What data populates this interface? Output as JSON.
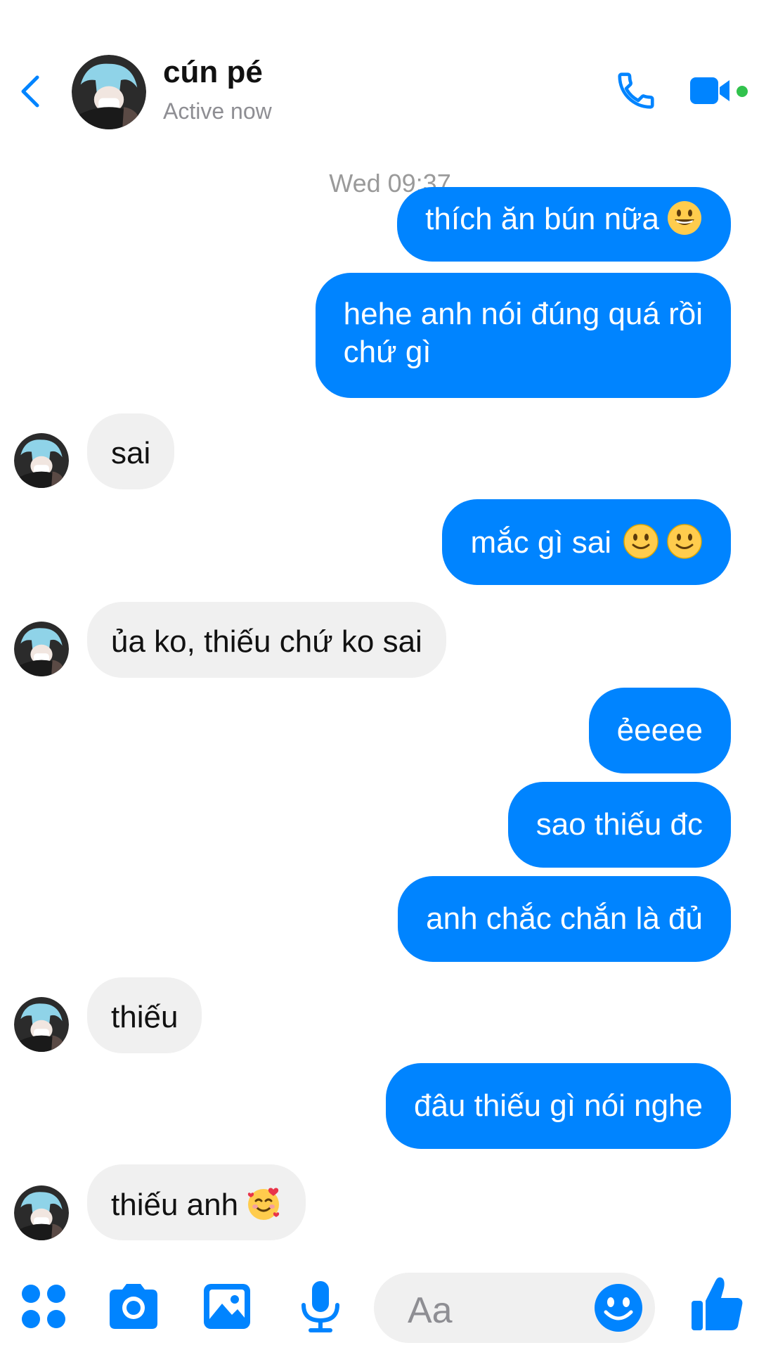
{
  "header": {
    "contact_name": "cún pé",
    "status": "Active now",
    "back_icon": "chevron-left-icon",
    "call_icon": "phone-icon",
    "video_icon": "video-camera-icon",
    "accent_color": "#0084ff",
    "active_color": "#31c24d"
  },
  "timestamp": "Wed 09:37",
  "messages": [
    {
      "from": "me",
      "text": "thích ăn bún nữa",
      "emoji": "grinning-face"
    },
    {
      "from": "me",
      "text_line1": "hehe anh nói đúng quá rồi",
      "text_line2": "chứ gì"
    },
    {
      "from": "contact",
      "text": "sai"
    },
    {
      "from": "me",
      "text": "mắc gì sai",
      "emoji": "slightly-smiling-face x2"
    },
    {
      "from": "contact",
      "text": "ủa ko, thiếu chứ ko sai"
    },
    {
      "from": "me",
      "text": "ẻeeee"
    },
    {
      "from": "me",
      "text": "sao thiếu đc"
    },
    {
      "from": "me",
      "text": "anh chắc chắn là đủ"
    },
    {
      "from": "contact",
      "text": "thiếu"
    },
    {
      "from": "me",
      "text": "đâu thiếu gì nói nghe"
    },
    {
      "from": "contact",
      "text": "thiếu anh",
      "emoji": "smiling-face-with-hearts"
    }
  ],
  "composer": {
    "placeholder": "Aa",
    "icons": [
      "apps-icon",
      "camera-icon",
      "image-icon",
      "microphone-icon",
      "emoji-icon",
      "like-icon"
    ]
  },
  "colors": {
    "outgoing_bubble": "#0084ff",
    "incoming_bubble": "#f0f0f0"
  }
}
